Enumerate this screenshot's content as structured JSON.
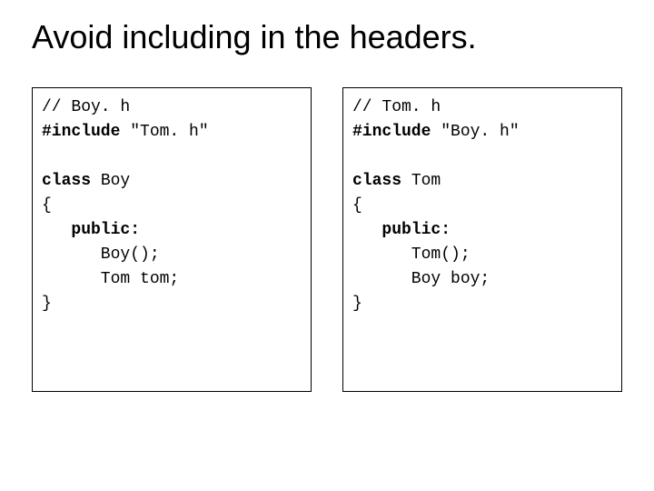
{
  "title": "Avoid including in the headers.",
  "left": {
    "l1": "// Boy. h",
    "l2a": "#include",
    "l2b": " \"Tom. h\"",
    "l3": "",
    "l4a": "class",
    "l4b": " Boy",
    "l5": "{",
    "l6a": "   ",
    "l6b": "public:",
    "l7": "      Boy();",
    "l8": "      Tom tom;",
    "l9": "}"
  },
  "right": {
    "l1": "// Tom. h",
    "l2a": "#include",
    "l2b": " \"Boy. h\"",
    "l3": "",
    "l4a": "class",
    "l4b": " Tom",
    "l5": "{",
    "l6a": "   ",
    "l6b": "public:",
    "l7": "      Tom();",
    "l8": "      Boy boy;",
    "l9": "}"
  }
}
